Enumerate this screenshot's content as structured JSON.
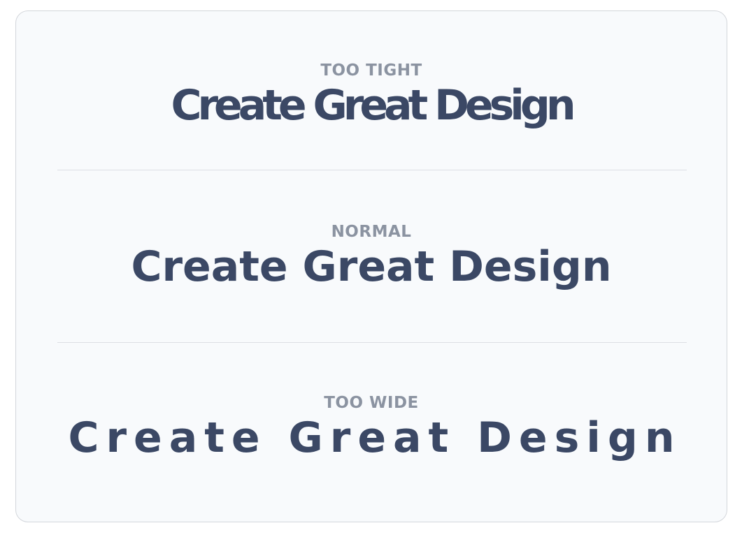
{
  "sections": [
    {
      "label": "TOO TIGHT",
      "sample": "Create Great Design"
    },
    {
      "label": "NORMAL",
      "sample": "Create Great Design"
    },
    {
      "label": "TOO WIDE",
      "sample": "Create Great Design"
    }
  ],
  "colors": {
    "label": "#8b93a1",
    "sample": "#3b4865",
    "card_background": "#f8fafc",
    "card_border": "#d3d6db",
    "divider": "#dcdfe4"
  }
}
